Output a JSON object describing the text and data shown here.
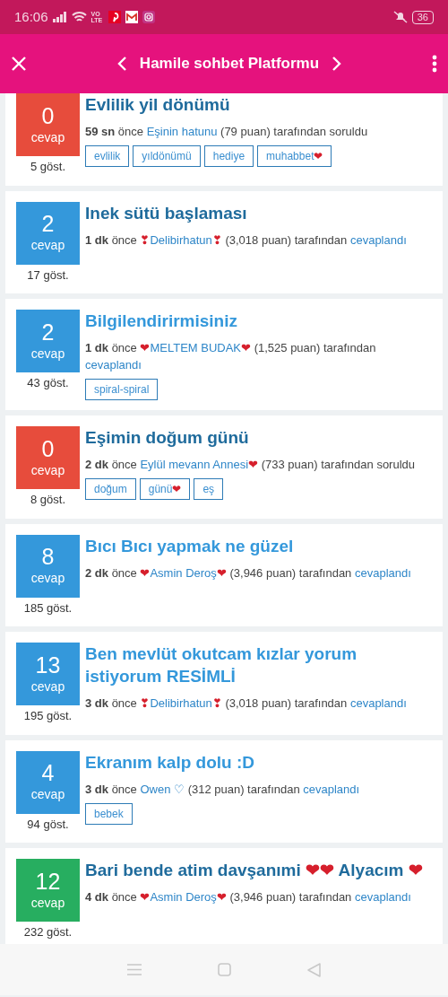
{
  "status_bar": {
    "time": "16:06",
    "network": "VO LTE",
    "battery": "36"
  },
  "toolbar": {
    "title": "Hamile sohbet Platformu"
  },
  "questions": [
    {
      "count": "0",
      "count_label": "cevap",
      "color": "#e74c3c",
      "views": "5 göst.",
      "title": "Evlilik yil dönümü",
      "visited": true,
      "time": "59 sn",
      "ago": "önce",
      "user": "Eşinin hatunu",
      "points": "(79 puan) tarafından",
      "action": "soruldu",
      "action_link": false,
      "tags": [
        "evlilik",
        "yıldönümü",
        "hediye",
        "muhabbet❤"
      ]
    },
    {
      "count": "2",
      "count_label": "cevap",
      "color": "#3498db",
      "views": "17 göst.",
      "title": "Inek sütü başlaması",
      "visited": true,
      "time": "1 dk",
      "ago": "önce",
      "user": "❣Delibirhatun❣",
      "points": "(3,018 puan) tarafından",
      "action": "cevaplandı",
      "action_link": true
    },
    {
      "count": "2",
      "count_label": "cevap",
      "color": "#3498db",
      "views": "43 göst.",
      "title": "Bilgilendirirmisiniz",
      "visited": false,
      "time": "1 dk",
      "ago": "önce",
      "user": "❤MELTEM BUDAK❤",
      "points": "(1,525 puan) tarafından",
      "action": "cevaplandı",
      "action_link": true,
      "tags": [
        "spiral-spiral"
      ]
    },
    {
      "count": "0",
      "count_label": "cevap",
      "color": "#e74c3c",
      "views": "8 göst.",
      "title": "Eşimin doğum günü",
      "visited": true,
      "time": "2 dk",
      "ago": "önce",
      "user": "Eylül mevann Annesi❤",
      "points": "(733 puan) tarafından",
      "action": "soruldu",
      "action_link": false,
      "tags": [
        "doğum",
        "günü❤",
        "eş"
      ]
    },
    {
      "count": "8",
      "count_label": "cevap",
      "color": "#3498db",
      "views": "185 göst.",
      "title": "Bıcı Bıcı yapmak ne güzel",
      "visited": false,
      "time": "2 dk",
      "ago": "önce",
      "user": "❤Asmin Deroş❤",
      "points": "(3,946 puan) tarafından",
      "action": "cevaplandı",
      "action_link": true
    },
    {
      "count": "13",
      "count_label": "cevap",
      "color": "#3498db",
      "views": "195 göst.",
      "title": "Ben mevlüt okutcam kızlar yorum istiyorum RESİMLİ",
      "visited": false,
      "time": "3 dk",
      "ago": "önce",
      "user": "❣Delibirhatun❣",
      "points": "(3,018 puan) tarafından",
      "action": "cevaplandı",
      "action_link": true
    },
    {
      "count": "4",
      "count_label": "cevap",
      "color": "#3498db",
      "views": "94 göst.",
      "title": "Ekranım kalp dolu :D",
      "visited": false,
      "time": "3 dk",
      "ago": "önce",
      "user": "Owen ♡",
      "points": "(312 puan) tarafından",
      "action": "cevaplandı",
      "action_link": true,
      "tags": [
        "bebek"
      ]
    },
    {
      "count": "12",
      "count_label": "cevap",
      "color": "#27ae60",
      "views": "232 göst.",
      "title": "Bari bende atim davşanımi ❤❤ Alyacım ❤",
      "visited": true,
      "time": "4 dk",
      "ago": "önce",
      "user": "❤Asmin Deroş❤",
      "points": "(3,946 puan) tarafından",
      "action": "cevaplandı",
      "action_link": true
    }
  ]
}
